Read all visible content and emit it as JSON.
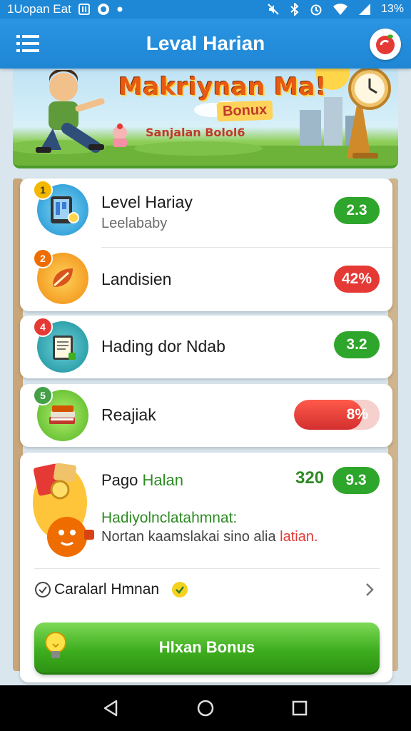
{
  "status_bar": {
    "carrier": "1Uopan Eat",
    "battery": "13%"
  },
  "app_bar": {
    "title": "Leval Harian"
  },
  "banner": {
    "headline": "Makriynan Ma!",
    "bonus": "Bonux",
    "subtitle": "Sanjalan Bolol6"
  },
  "tasks": [
    {
      "number": "1",
      "title": "Level Hariay",
      "subtitle": "Leelababy",
      "value": "2.3",
      "status_color": "#2ea52b",
      "icon": "tablet-icon"
    },
    {
      "number": "2",
      "title": "Landisien",
      "subtitle": "",
      "value": "42%",
      "status_color": "#e53935",
      "icon": "leaf-icon"
    },
    {
      "number": "4",
      "title": "Hading dor Ndab",
      "subtitle": "",
      "value": "3.2",
      "status_color": "#2ea52b",
      "icon": "document-icon"
    },
    {
      "number": "5",
      "title": "Reajiak",
      "subtitle": "",
      "value": "8%",
      "progress": 0.8,
      "status_color": "#e53935",
      "icon": "books-icon"
    }
  ],
  "reward": {
    "title_part1": "Pago ",
    "title_part2": "Halan",
    "points": "320",
    "value": "9.3",
    "subtitle_green": "Hadiyolnclatahmnat:",
    "subtitle_text": "Nortan kaamslakai sino alia ",
    "subtitle_highlight": "latian."
  },
  "link": {
    "label": "Caralarl Hmnan"
  },
  "cta": {
    "label": "Hlxan Bonus"
  }
}
